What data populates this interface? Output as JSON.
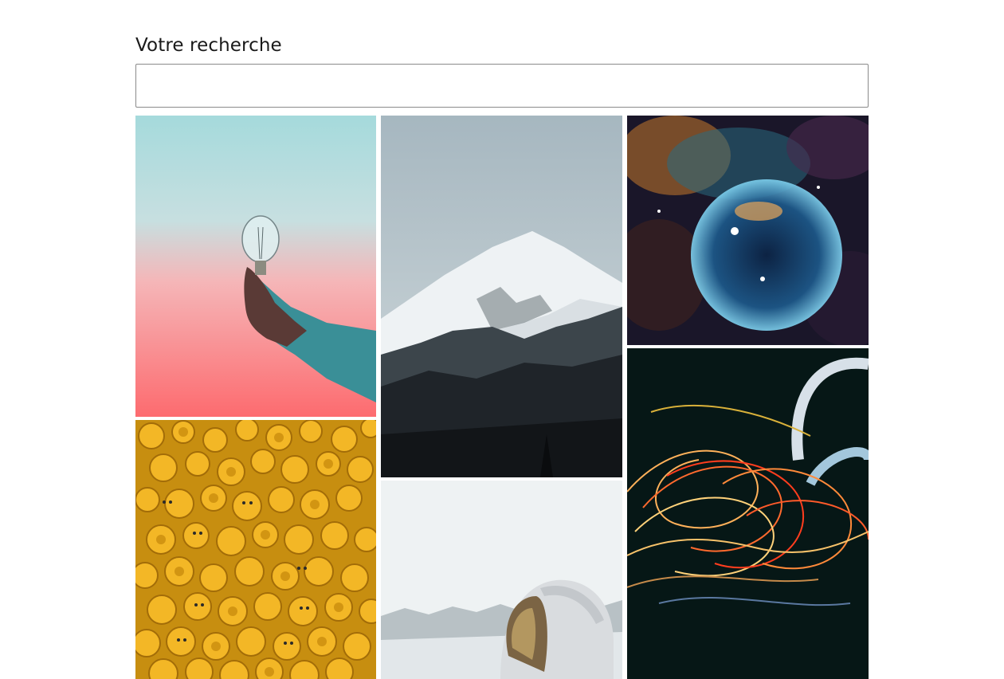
{
  "search": {
    "label": "Votre recherche",
    "value": "",
    "placeholder": ""
  },
  "gallery": {
    "images": [
      {
        "subject": "lightbulb-in-hand"
      },
      {
        "subject": "snowy-mountain"
      },
      {
        "subject": "bubble-nebula"
      },
      {
        "subject": "yellow-toy-heads"
      },
      {
        "subject": "astronaut-helmet"
      },
      {
        "subject": "light-trails"
      }
    ]
  }
}
